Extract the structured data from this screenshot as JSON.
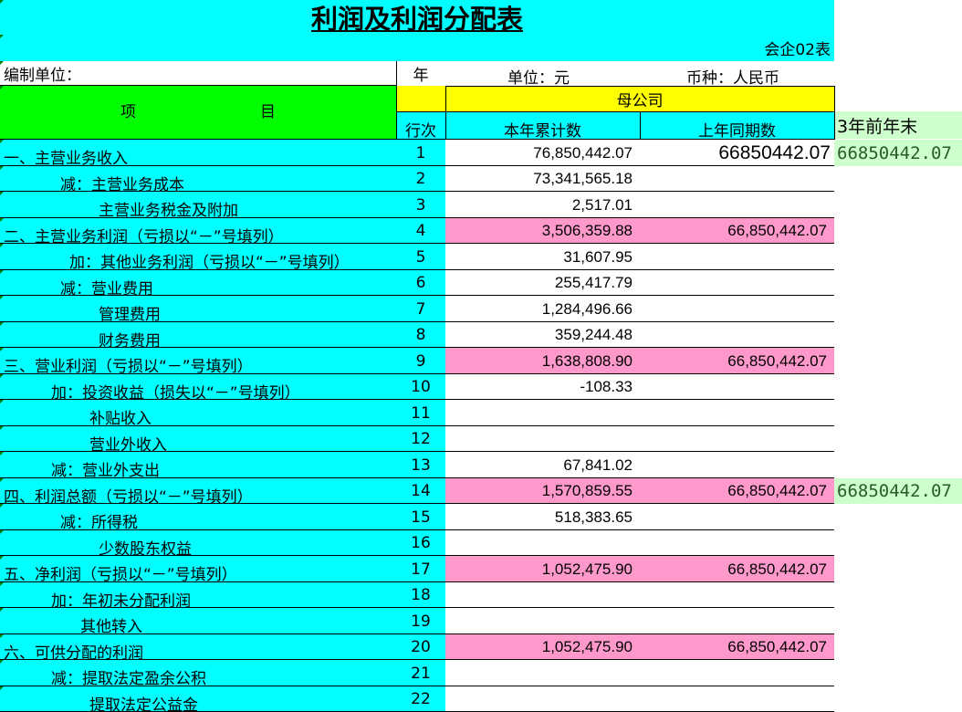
{
  "title": "利润及利润分配表",
  "form_code": "会企02表",
  "meta": {
    "unit_label": "编制单位：",
    "year_label": "年",
    "currency_unit": "单位：元",
    "currency": "币种：人民币"
  },
  "header": {
    "item": "项　　　　　　　　目",
    "parent": "母公司",
    "line_no": "行次",
    "current": "本年累计数",
    "previous": "上年同期数",
    "extra": "3年前年末"
  },
  "rows": [
    {
      "label": "一、主营业务收入",
      "indent": 0,
      "no": "1",
      "cur": "76,850,442.07",
      "prev": "66850442.07",
      "prev_big": true,
      "extra": "66850442.07",
      "pink": false
    },
    {
      "label": "减：主营业务成本",
      "indent": 62,
      "no": "2",
      "cur": "73,341,565.18",
      "prev": "",
      "extra": "",
      "pink": false
    },
    {
      "label": "主营业务税金及附加",
      "indent": 104,
      "no": "3",
      "cur": "2,517.01",
      "prev": "",
      "extra": "",
      "pink": false
    },
    {
      "label": "二、主营业务利润（亏损以“－”号填列）",
      "indent": 0,
      "no": "4",
      "cur": "3,506,359.88",
      "prev": "66,850,442.07",
      "extra": "",
      "pink": true
    },
    {
      "label": "加：其他业务利润（亏损以“－”号填列）",
      "indent": 72,
      "no": "5",
      "cur": "31,607.95",
      "prev": "",
      "extra": "",
      "pink": false
    },
    {
      "label": "减：营业费用",
      "indent": 62,
      "no": "6",
      "cur": "255,417.79",
      "prev": "",
      "extra": "",
      "pink": false
    },
    {
      "label": "管理费用",
      "indent": 104,
      "no": "7",
      "cur": "1,284,496.66",
      "prev": "",
      "extra": "",
      "pink": false
    },
    {
      "label": "财务费用",
      "indent": 104,
      "no": "8",
      "cur": "359,244.48",
      "prev": "",
      "extra": "",
      "pink": false
    },
    {
      "label": "三、营业利润（亏损以“－”号填列）",
      "indent": 0,
      "no": "9",
      "cur": "1,638,808.90",
      "prev": "66,850,442.07",
      "extra": "",
      "pink": true
    },
    {
      "label": "加：投资收益（损失以“－”号填列）",
      "indent": 52,
      "no": "10",
      "cur": "-108.33",
      "prev": "",
      "extra": "",
      "pink": false
    },
    {
      "label": "补贴收入",
      "indent": 94,
      "no": "11",
      "cur": "",
      "prev": "",
      "extra": "",
      "pink": false
    },
    {
      "label": "营业外收入",
      "indent": 94,
      "no": "12",
      "cur": "",
      "prev": "",
      "extra": "",
      "pink": false
    },
    {
      "label": "减：营业外支出",
      "indent": 52,
      "no": "13",
      "cur": "67,841.02",
      "prev": "",
      "extra": "",
      "pink": false
    },
    {
      "label": "四、利润总额（亏损以“－”号填列）",
      "indent": 0,
      "no": "14",
      "cur": "1,570,859.55",
      "prev": "66,850,442.07",
      "extra": "66850442.07",
      "pink": true
    },
    {
      "label": "减：所得税",
      "indent": 62,
      "no": "15",
      "cur": "518,383.65",
      "prev": "",
      "extra": "",
      "pink": false
    },
    {
      "label": "少数股东权益",
      "indent": 104,
      "no": "16",
      "cur": "",
      "prev": "",
      "extra": "",
      "pink": false
    },
    {
      "label": "五、净利润（亏损以“－”号填列）",
      "indent": 0,
      "no": "17",
      "cur": "1,052,475.90",
      "prev": "66,850,442.07",
      "extra": "",
      "pink": true
    },
    {
      "label": "加：年初未分配利润",
      "indent": 52,
      "no": "18",
      "cur": "",
      "prev": "",
      "extra": "",
      "pink": false
    },
    {
      "label": "其他转入",
      "indent": 84,
      "no": "19",
      "cur": "",
      "prev": "",
      "extra": "",
      "pink": false
    },
    {
      "label": "六、可供分配的利润",
      "indent": 0,
      "no": "20",
      "cur": "1,052,475.90",
      "prev": "66,850,442.07",
      "extra": "",
      "pink": true
    },
    {
      "label": "减：提取法定盈余公积",
      "indent": 52,
      "no": "21",
      "cur": "",
      "prev": "",
      "extra": "",
      "pink": false
    },
    {
      "label": "提取法定公益金",
      "indent": 94,
      "no": "22",
      "cur": "",
      "prev": "",
      "extra": "",
      "pink": false
    }
  ]
}
